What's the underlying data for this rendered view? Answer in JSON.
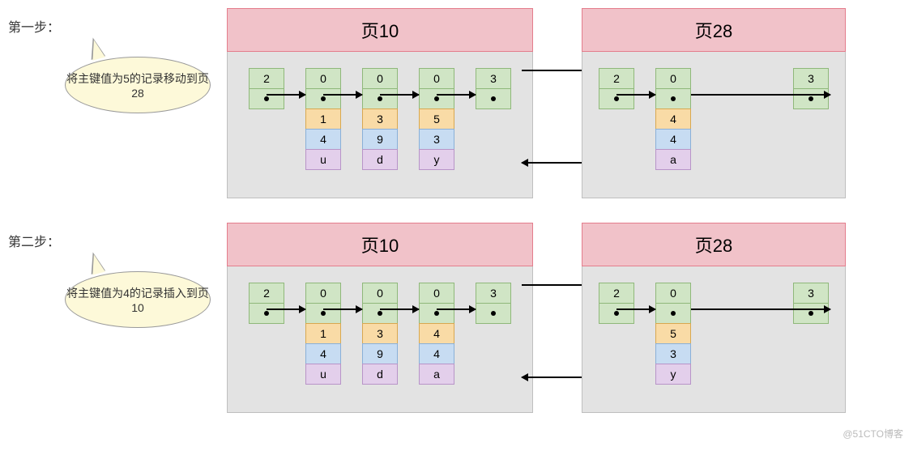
{
  "watermark": "@51CTO博客",
  "steps": [
    {
      "label": "第一步：",
      "speech": "将主键值为5的记录移动到页28",
      "page10": {
        "title": "页10",
        "columns": [
          {
            "type": "head",
            "cells": [
              "2",
              "•"
            ]
          },
          {
            "type": "data",
            "cells": [
              "0",
              "•",
              "1",
              "4",
              "u"
            ]
          },
          {
            "type": "data",
            "cells": [
              "0",
              "•",
              "3",
              "9",
              "d"
            ]
          },
          {
            "type": "data",
            "cells": [
              "0",
              "•",
              "5",
              "3",
              "y"
            ]
          },
          {
            "type": "tail",
            "cells": [
              "3",
              "•"
            ]
          }
        ]
      },
      "page28": {
        "title": "页28",
        "columns": [
          {
            "type": "head",
            "cells": [
              "2",
              "•"
            ]
          },
          {
            "type": "data",
            "cells": [
              "0",
              "•",
              "4",
              "4",
              "a"
            ]
          },
          {
            "type": "tail",
            "cells": [
              "3",
              "•"
            ]
          }
        ]
      }
    },
    {
      "label": "第二步：",
      "speech": "将主键值为4的记录插入到页10",
      "page10": {
        "title": "页10",
        "columns": [
          {
            "type": "head",
            "cells": [
              "2",
              "•"
            ]
          },
          {
            "type": "data",
            "cells": [
              "0",
              "•",
              "1",
              "4",
              "u"
            ]
          },
          {
            "type": "data",
            "cells": [
              "0",
              "•",
              "3",
              "9",
              "d"
            ]
          },
          {
            "type": "data",
            "cells": [
              "0",
              "•",
              "4",
              "4",
              "a"
            ]
          },
          {
            "type": "tail",
            "cells": [
              "3",
              "•"
            ]
          }
        ]
      },
      "page28": {
        "title": "页28",
        "columns": [
          {
            "type": "head",
            "cells": [
              "2",
              "•"
            ]
          },
          {
            "type": "data",
            "cells": [
              "0",
              "•",
              "5",
              "3",
              "y"
            ]
          },
          {
            "type": "tail",
            "cells": [
              "3",
              "•"
            ]
          }
        ]
      }
    }
  ]
}
